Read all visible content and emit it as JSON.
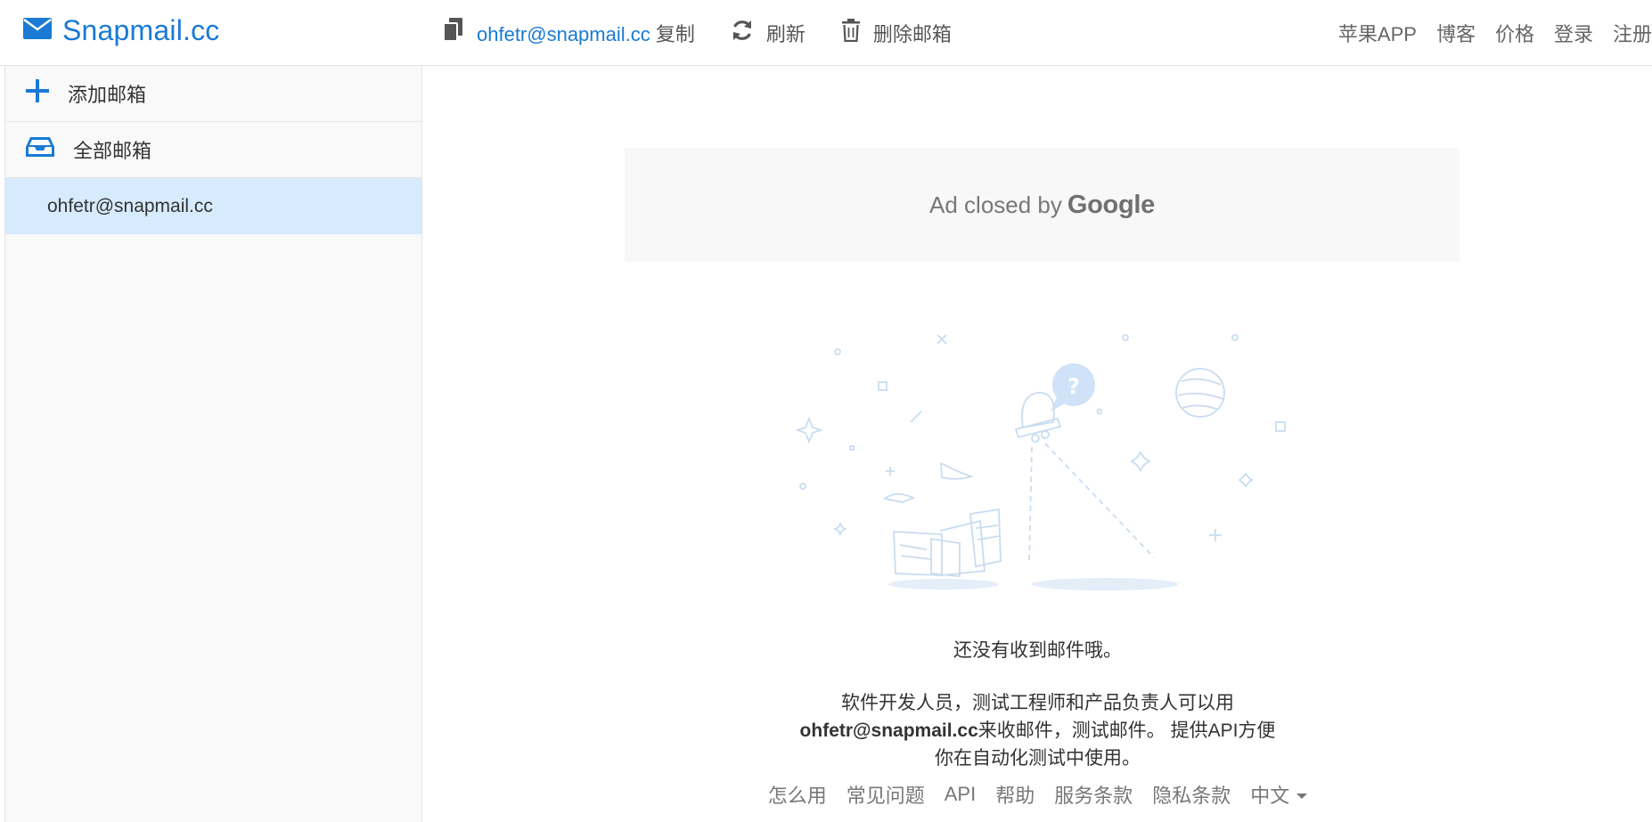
{
  "brand": {
    "name": "Snapmail.cc",
    "color": "#1a7ad4",
    "icon": "envelope-icon"
  },
  "toolbar": {
    "email": "ohfetr@snapmail.cc",
    "copy_label": "复制",
    "refresh_label": "刷新",
    "delete_label": "删除邮箱"
  },
  "nav": {
    "items": [
      "苹果APP",
      "博客",
      "价格",
      "登录",
      "注册"
    ]
  },
  "sidebar": {
    "add_label": "添加邮箱",
    "all_label": "全部邮箱",
    "mailbox": "ohfetr@snapmail.cc",
    "selected_color": "#d6ebfd"
  },
  "ad": {
    "text": "Ad closed by",
    "brand": "Google"
  },
  "empty": {
    "title": "还没有收到邮件哦。",
    "line1": "软件开发人员，测试工程师和产品负责人可以用",
    "line2_email": "ohfetr@snapmail.cc",
    "line2_rest": "来收邮件，测试邮件。 提供API方便",
    "line3": "你在自动化测试中使用。"
  },
  "footer": {
    "links": [
      "怎么用",
      "常见问题",
      "API",
      "帮助",
      "服务条款",
      "隐私条款"
    ],
    "language": "中文"
  }
}
